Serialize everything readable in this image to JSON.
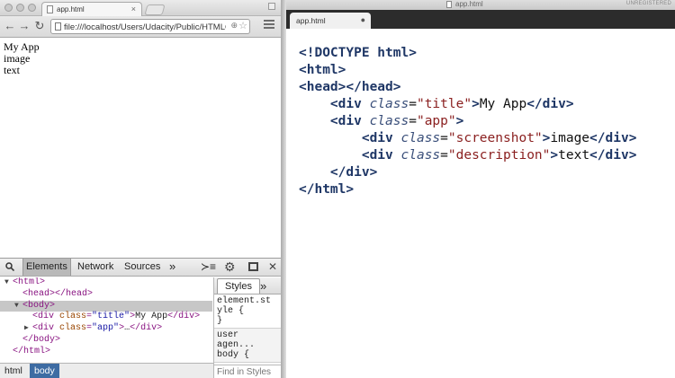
{
  "browser": {
    "tab": {
      "label": "app.html",
      "close": "×"
    },
    "address": "file:///localhost/Users/Udacity/Public/HTMLC...",
    "page_lines": [
      "My App",
      "image",
      "text"
    ]
  },
  "devtools": {
    "tabs": [
      "Elements",
      "Network",
      "Sources"
    ],
    "more": "»",
    "dom": [
      {
        "indent": 0,
        "toggle": "▼",
        "tag_open": "<html>"
      },
      {
        "indent": 1,
        "toggle": "",
        "tag_open": "<head></head>"
      },
      {
        "indent": 1,
        "toggle": "▼",
        "tag_open": "<body>",
        "selected": true
      },
      {
        "indent": 2,
        "toggle": "",
        "prefix": "<div ",
        "attr_name": "class",
        "attr_val": "\"title\"",
        "close": ">",
        "text": "My App",
        "end": "</div>"
      },
      {
        "indent": 2,
        "toggle": "▶",
        "prefix": "<div ",
        "attr_name": "class",
        "attr_val": "\"app\"",
        "close": ">",
        "text": "…",
        "end": "</div>"
      },
      {
        "indent": 1,
        "toggle": "",
        "tag_open": "</body>"
      },
      {
        "indent": 0,
        "toggle": "",
        "tag_open": "</html>"
      }
    ],
    "styles": {
      "tab": "Styles",
      "more": "»",
      "element_block": [
        "element.st",
        "yle {",
        "}"
      ],
      "ua_block": [
        "user agen...",
        "body {"
      ],
      "find_placeholder": "Find in Styles"
    },
    "breadcrumbs": [
      "html",
      "body"
    ]
  },
  "editor": {
    "window_title": "app.html",
    "unregistered": "UNREGISTERED",
    "tab": {
      "label": "app.html",
      "dirty": "●"
    },
    "code": [
      [
        [
          "tg",
          "<!DOCTYPE html>"
        ]
      ],
      [
        [
          "tg",
          "<html>"
        ]
      ],
      [
        [
          "tg",
          "<head></head>"
        ]
      ],
      [
        [
          "pl",
          "    "
        ],
        [
          "tg",
          "<div "
        ],
        [
          "at",
          "class"
        ],
        [
          "pl",
          "="
        ],
        [
          "st",
          "\"title\""
        ],
        [
          "tg",
          ">"
        ],
        [
          "pl",
          "My App"
        ],
        [
          "tg",
          "</div>"
        ]
      ],
      [
        [
          "pl",
          "    "
        ],
        [
          "tg",
          "<div "
        ],
        [
          "at",
          "class"
        ],
        [
          "pl",
          "="
        ],
        [
          "st",
          "\"app\""
        ],
        [
          "tg",
          ">"
        ]
      ],
      [
        [
          "pl",
          "        "
        ],
        [
          "tg",
          "<div "
        ],
        [
          "at",
          "class"
        ],
        [
          "pl",
          "="
        ],
        [
          "st",
          "\"screenshot\""
        ],
        [
          "tg",
          ">"
        ],
        [
          "pl",
          "image"
        ],
        [
          "tg",
          "</div>"
        ]
      ],
      [
        [
          "pl",
          "        "
        ],
        [
          "tg",
          "<div "
        ],
        [
          "at",
          "class"
        ],
        [
          "pl",
          "="
        ],
        [
          "st",
          "\"description\""
        ],
        [
          "tg",
          ">"
        ],
        [
          "pl",
          "text"
        ],
        [
          "tg",
          "</div>"
        ]
      ],
      [
        [
          "pl",
          "    "
        ],
        [
          "tg",
          "</div>"
        ]
      ],
      [
        [
          "tg",
          "</html>"
        ]
      ]
    ]
  }
}
